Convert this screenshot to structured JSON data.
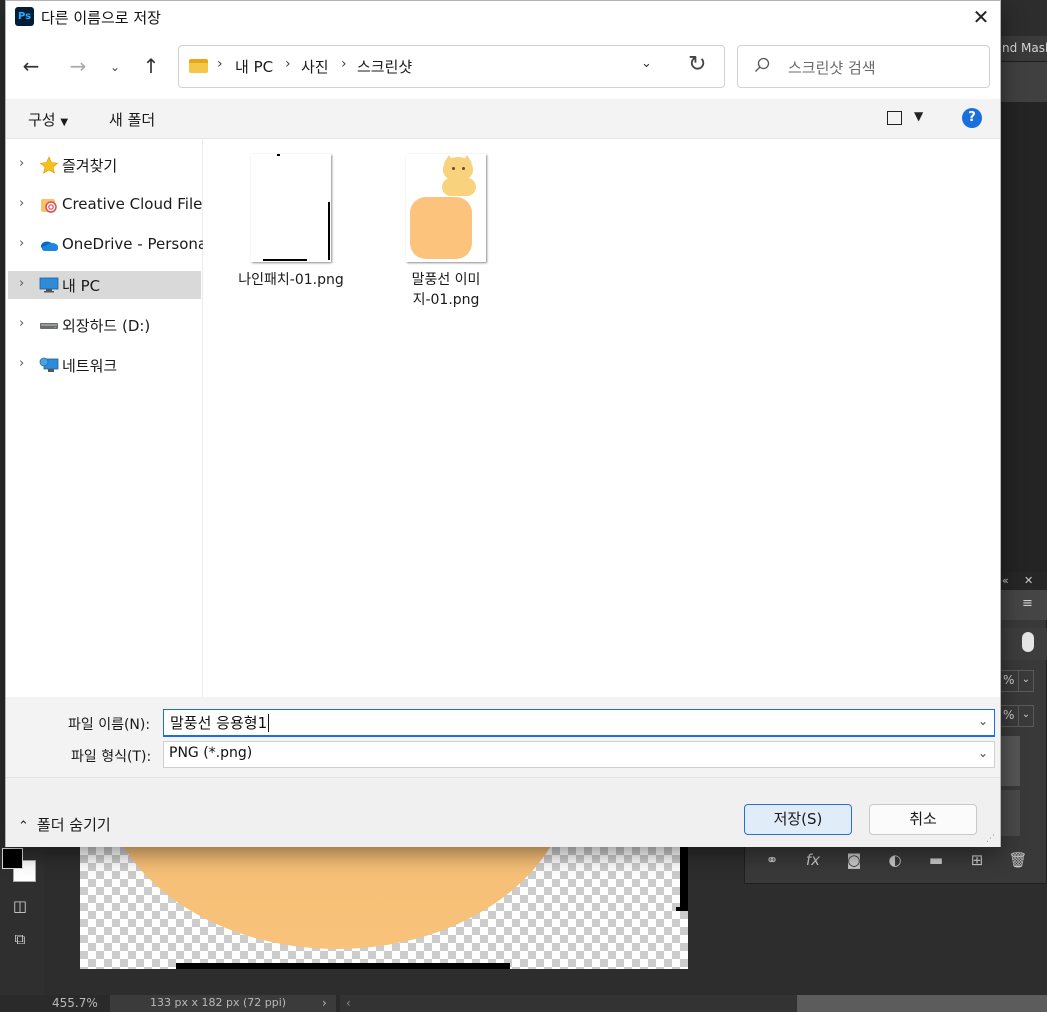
{
  "dialog": {
    "title": "다른 이름으로 저장",
    "app_icon": "Ps"
  },
  "nav": {
    "breadcrumbs": [
      "내 PC",
      "사진",
      "스크린샷"
    ],
    "search_placeholder": "스크린샷 검색"
  },
  "commands": {
    "organize": "구성",
    "new_folder": "새 폴더",
    "help": "?"
  },
  "sidebar": {
    "items": [
      {
        "label": "즐겨찾기",
        "icon": "star-icon"
      },
      {
        "label": "Creative Cloud Files",
        "icon": "creative-cloud-icon"
      },
      {
        "label": "OneDrive - Personal",
        "icon": "onedrive-icon"
      },
      {
        "label": "내 PC",
        "icon": "computer-icon",
        "selected": true
      },
      {
        "label": "외장하드 (D:)",
        "icon": "drive-icon"
      },
      {
        "label": "네트워크",
        "icon": "network-icon"
      }
    ]
  },
  "files": [
    {
      "name": "나인패치-01.png"
    },
    {
      "name": "말풍선 이미지-01.png"
    }
  ],
  "form": {
    "filename_label": "파일 이름(N):",
    "filename_value": "말풍선 응용형1",
    "filetype_label": "파일 형식(T):",
    "filetype_value": "PNG (*.png)"
  },
  "footer": {
    "hide_folders": "폴더 숨기기",
    "save": "저장(S)",
    "cancel": "취소"
  },
  "photoshop": {
    "right_tab": "nd Mask",
    "zoom": "455.7%",
    "doc_info": "133 px x 182 px (72 ppi)",
    "panel_field_1": "%",
    "panel_field_2": "%"
  },
  "colors": {
    "accent": "#1a6fdf",
    "selected": "#d9d9d9",
    "bubble": "#f8c27a"
  }
}
